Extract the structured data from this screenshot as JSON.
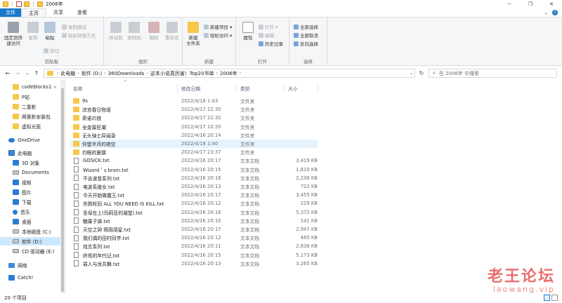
{
  "window": {
    "title": "2006年",
    "minimize": "─",
    "maximize": "❐",
    "close": "✕"
  },
  "tabs": {
    "file": "文件",
    "home": "主页",
    "share": "共享",
    "view": "查看",
    "expand": "⌄",
    "help": "?"
  },
  "ribbon": {
    "clipboard": {
      "label": "剪贴板",
      "pin_quick_access": "固定到快\n速访问",
      "copy": "复制",
      "paste": "粘贴",
      "copy_path": "复制路径",
      "paste_shortcut": "粘贴快捷方式",
      "cut": "剪切"
    },
    "organize": {
      "label": "组织",
      "move_to": "移动到",
      "copy_to": "复制到",
      "delete": "删除",
      "rename": "重命名"
    },
    "new": {
      "label": "新建",
      "new_folder": "新建\n文件夹",
      "new_item": "新建项目 ▾",
      "easy_access": "轻松访问 ▾"
    },
    "open": {
      "label": "打开",
      "properties": "属性",
      "open": "打开 ▾",
      "edit": "编辑",
      "history": "历史记录"
    },
    "select": {
      "label": "选择",
      "select_all": "全部选择",
      "select_none": "全部取消",
      "invert": "反向选择"
    }
  },
  "address": {
    "back": "←",
    "forward": "→",
    "recent": "⌄",
    "up": "↑",
    "crumbs": [
      "此电脑",
      "软件 (D:)",
      "360Downloads",
      "这本小说真厉害！Top20书单",
      "2006年"
    ],
    "sep": "›",
    "dropdown": "⌄",
    "refresh": "↻",
    "search_placeholder": "在 2006年 中搜索",
    "search_icon": "⌕"
  },
  "nav": {
    "items": [
      {
        "label": "codeblocks1",
        "icon": "folder-icon",
        "pinned": "⇲"
      },
      {
        "label": "P站",
        "icon": "folder-icon"
      },
      {
        "label": "二重影",
        "icon": "folder-icon"
      },
      {
        "label": "两重影安装包",
        "icon": "folder-icon"
      },
      {
        "label": "虚拟光驱",
        "icon": "folder-icon"
      },
      {
        "label": "OneDrive",
        "icon": "onedrive-icon"
      },
      {
        "label": "此电脑",
        "icon": "this-pc-icon"
      },
      {
        "label": "3D 对象",
        "icon": "3d-objects-icon"
      },
      {
        "label": "Documents",
        "icon": "documents-icon"
      },
      {
        "label": "视频",
        "icon": "videos-icon"
      },
      {
        "label": "图片",
        "icon": "pictures-icon"
      },
      {
        "label": "下载",
        "icon": "downloads-icon"
      },
      {
        "label": "音乐",
        "icon": "music-icon"
      },
      {
        "label": "桌面",
        "icon": "desktop-icon"
      },
      {
        "label": "本地磁盘 (C:)",
        "icon": "drive-c-icon"
      },
      {
        "label": "软件 (D:)",
        "icon": "drive-d-icon"
      },
      {
        "label": "CD 驱动器 (E:)",
        "icon": "cd-drive-icon"
      },
      {
        "label": "网络",
        "icon": "network-icon"
      },
      {
        "label": "Catch!",
        "icon": "catch-icon"
      }
    ]
  },
  "list": {
    "headers": {
      "name": "名称",
      "modified": "修改日期",
      "type": "类型",
      "size": "大小"
    },
    "sort_caret": "^",
    "rows": [
      {
        "name": "9s",
        "modified": "2022/4/18 1:43",
        "type": "文件夹",
        "size": "",
        "kind": "folder"
      },
      {
        "name": "凉宫春日物语",
        "modified": "2022/4/17 22:35",
        "type": "文件夹",
        "size": "",
        "kind": "folder"
      },
      {
        "name": "奇诺の旅",
        "modified": "2022/4/17 22:32",
        "type": "文件夹",
        "size": "",
        "kind": "folder"
      },
      {
        "name": "全金属狂潮",
        "modified": "2022/4/17 10:20",
        "type": "文件夹",
        "size": "",
        "kind": "folder"
      },
      {
        "name": "无头骑士异闻录",
        "modified": "2022/4/16 20:14",
        "type": "文件夹",
        "size": "",
        "kind": "folder"
      },
      {
        "name": "仰望半月的夜空",
        "modified": "2022/4/18 1:40",
        "type": "文件夹",
        "size": "",
        "kind": "folder"
      },
      {
        "name": "灼眼的夏娜",
        "modified": "2022/4/17 23:37",
        "type": "文件夹",
        "size": "",
        "kind": "folder"
      },
      {
        "name": "GOSICK.txt",
        "modified": "2022/4/16 20:17",
        "type": "文本文档",
        "size": "3,419 KB",
        "kind": "txt"
      },
      {
        "name": "Wizard＇s brain.txt",
        "modified": "2022/4/16 20:15",
        "type": "文本文档",
        "size": "1,810 KB",
        "kind": "txt"
      },
      {
        "name": "不吉波普系列.txt",
        "modified": "2022/4/16 20:16",
        "type": "文本文档",
        "size": "2,236 KB",
        "kind": "txt"
      },
      {
        "name": "电波系彼女.txt",
        "modified": "2022/4/16 20:13",
        "type": "文本文档",
        "size": "722 KB",
        "kind": "txt"
      },
      {
        "name": "今天开始做魔王.txt",
        "modified": "2022/4/16 20:17",
        "type": "文本文档",
        "size": "3,455 KB",
        "kind": "txt"
      },
      {
        "name": "杀戮轮回 ALL YOU NEED IS KILL.txt",
        "modified": "2022/4/16 20:12",
        "type": "文本文档",
        "size": "229 KB",
        "kind": "txt"
      },
      {
        "name": "圣母在上(玛莉亚的凝望).txt",
        "modified": "2022/4/16 20:16",
        "type": "文本文档",
        "size": "5,372 KB",
        "kind": "txt"
      },
      {
        "name": "糖果子弹.txt",
        "modified": "2022/4/16 20:10",
        "type": "文本文档",
        "size": "141 KB",
        "kind": "txt"
      },
      {
        "name": "天空之钟 晴雨感星.txt",
        "modified": "2022/4/16 20:17",
        "type": "文本文档",
        "size": "2,947 KB",
        "kind": "txt"
      },
      {
        "name": "我们偶的田村同学.txt",
        "modified": "2022/4/16 20:12",
        "type": "文本文档",
        "size": "485 KB",
        "kind": "txt"
      },
      {
        "name": "戏言系列.txt",
        "modified": "2022/4/16 20:11",
        "type": "文本文档",
        "size": "2,838 KB",
        "kind": "txt"
      },
      {
        "name": "终焉的年代记.txt",
        "modified": "2022/4/16 20:15",
        "type": "文本文档",
        "size": "5,173 KB",
        "kind": "txt"
      },
      {
        "name": "罪人与龙共舞.txt",
        "modified": "2022/4/16 20:13",
        "type": "文本文档",
        "size": "3,265 KB",
        "kind": "txt"
      }
    ]
  },
  "status": {
    "count": "20 个项目"
  },
  "watermark": {
    "line1": "老王论坛",
    "line2": "laowang.vip"
  },
  "colors": {
    "accent": "#1979ca",
    "selection": "#cce8ff",
    "hover": "#e5f3ff",
    "folder": "#f6c748",
    "watermark": "#e13c3c"
  }
}
